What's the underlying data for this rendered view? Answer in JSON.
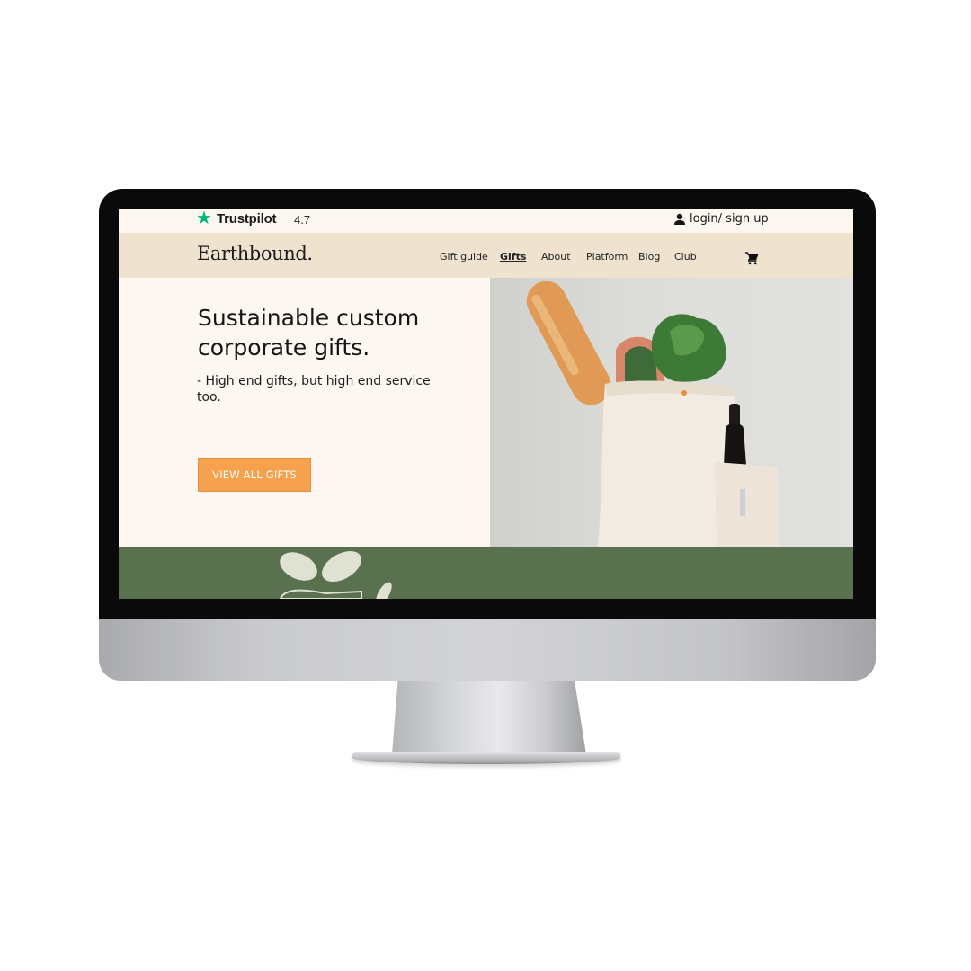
{
  "topbar": {
    "trustpilot_label": "Trustpilot",
    "trustpilot_rating": "4.7",
    "star_icon": "star-icon",
    "login_label": "login/ sign up",
    "login_icon": "user-icon"
  },
  "navbar": {
    "logo": "Earthbound.",
    "items": [
      {
        "label": "Gift guide",
        "active": false
      },
      {
        "label": "Gifts",
        "active": true
      },
      {
        "label": "About",
        "active": false
      },
      {
        "label": "Platform",
        "active": false
      },
      {
        "label": "Blog",
        "active": false
      },
      {
        "label": "Club",
        "active": false
      }
    ],
    "cart_icon": "cart-icon"
  },
  "hero": {
    "title": "Sustainable custom corporate gifts.",
    "subtitle": "- High end gifts, but high end service too.",
    "cta_label": "VIEW ALL GIFTS"
  },
  "colors": {
    "page_bg": "#fcf7f1",
    "nav_bg": "#efe3cf",
    "cta": "#f6a14d",
    "band_green": "#5a7150",
    "trustpilot_green": "#00b67a"
  }
}
